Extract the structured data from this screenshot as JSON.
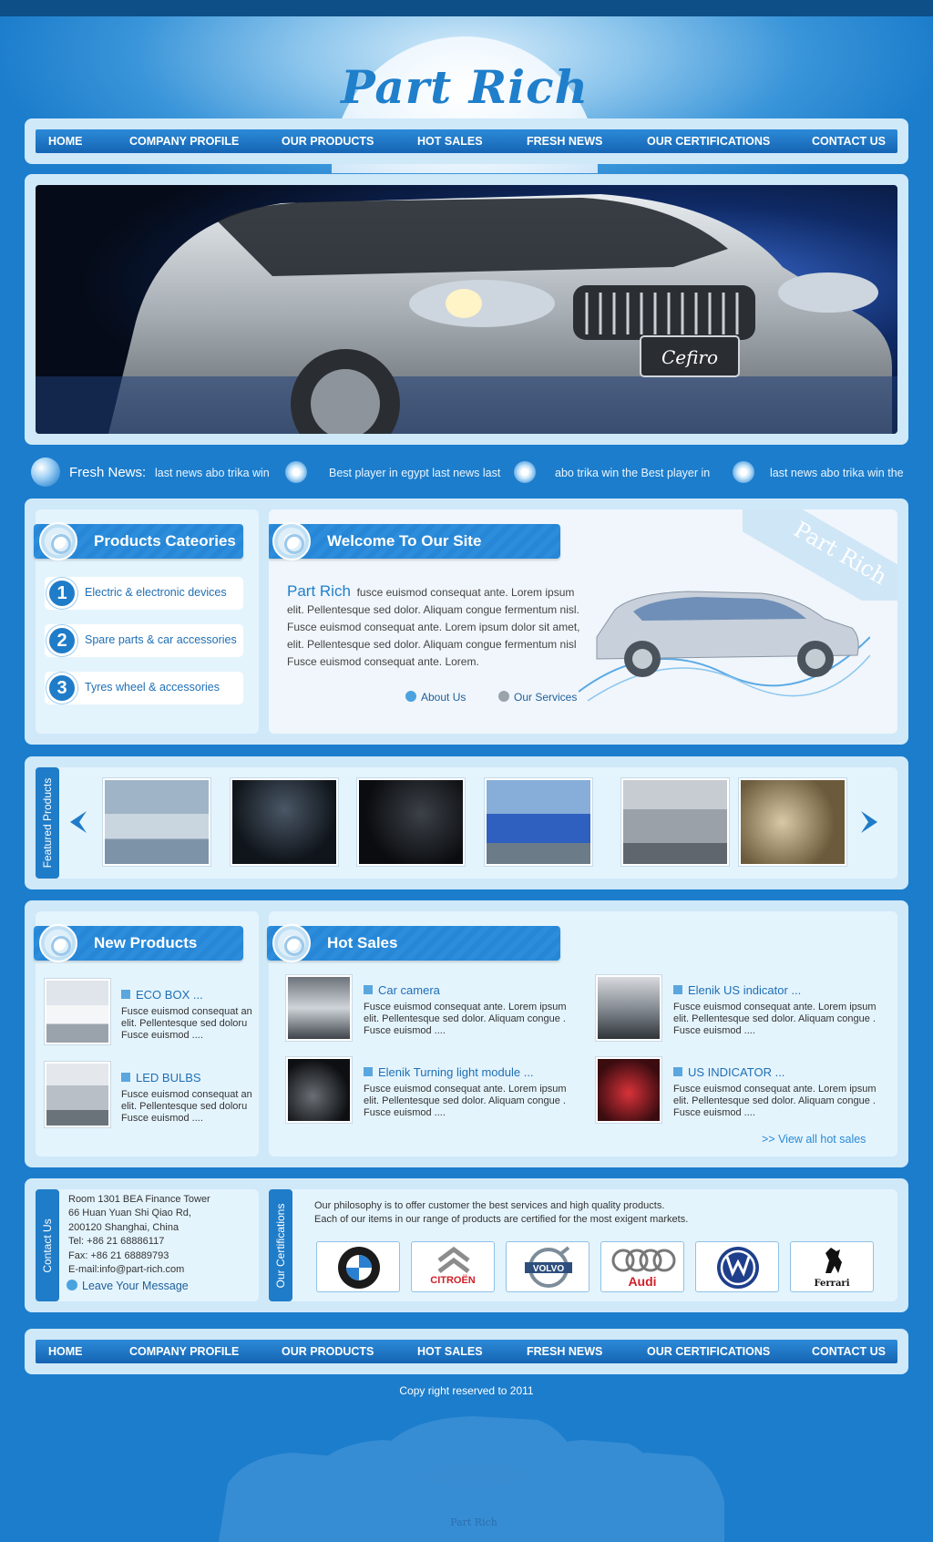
{
  "brand": {
    "logo": "Part Rich"
  },
  "nav": [
    "HOME",
    "COMPANY PROFILE",
    "OUR PRODUCTS",
    "HOT SALES",
    "FRESH NEWS",
    "OUR CERTIFICATIONS",
    "CONTACT US"
  ],
  "hero": {
    "badge": "Cefiro"
  },
  "news": {
    "label": "Fresh News:",
    "items": [
      "last news abo trika win",
      "Best player in egypt last news last",
      "abo trika win the  Best player in",
      "last news abo trika win the"
    ]
  },
  "categories": {
    "title": "Products Cateories",
    "items": [
      {
        "num": "1",
        "label": "Electric & electronic devices"
      },
      {
        "num": "2",
        "label": "Spare parts & car accessories"
      },
      {
        "num": "3",
        "label": "Tyres wheel & accessories"
      }
    ]
  },
  "welcome": {
    "title": "Welcome To Our Site",
    "ribbon": "Part Rich",
    "brand": "Part Rich",
    "text": "fusce euismod consequat ante. Lorem ipsum elit. Pellentesque sed dolor. Aliquam congue fermentum nisl. Fusce euismod consequat ante. Lorem ipsum dolor sit amet, elit. Pellentesque sed dolor. Aliquam congue fermentum nisl Fusce euismod consequat ante. Lorem.",
    "about": "About Us",
    "services": "Our Services"
  },
  "featured": {
    "label": "Featured Products"
  },
  "new_products": {
    "title": "New Products",
    "items": [
      {
        "title": "ECO BOX ...",
        "desc": "Fusce euismod consequat an elit. Pellentesque sed doloru Fusce euismod   ...."
      },
      {
        "title": "LED BULBS",
        "desc": "Fusce euismod consequat an elit. Pellentesque sed doloru Fusce euismod   ...."
      }
    ]
  },
  "hot_sales": {
    "title": "Hot Sales",
    "items": [
      {
        "title": "Car camera",
        "desc": "Fusce euismod consequat ante. Lorem ipsum elit. Pellentesque sed dolor. Aliquam congue . Fusce euismod   ...."
      },
      {
        "title": "Elenik US indicator  ...",
        "desc": "Fusce euismod consequat ante. Lorem ipsum elit. Pellentesque sed dolor. Aliquam congue . Fusce euismod   ...."
      },
      {
        "title": "Elenik Turning light module  ...",
        "desc": "Fusce euismod consequat ante. Lorem ipsum elit. Pellentesque sed dolor. Aliquam congue . Fusce euismod   ...."
      },
      {
        "title": "US INDICATOR  ...",
        "desc": "Fusce euismod consequat ante. Lorem ipsum elit. Pellentesque sed dolor. Aliquam congue . Fusce euismod   ...."
      }
    ],
    "view_all": ">> View all hot sales"
  },
  "contact": {
    "label": "Contact Us",
    "lines": [
      "Room 1301 BEA Finance Tower",
      "66 Huan Yuan Shi Qiao Rd,",
      "200120 Shanghai, China",
      "Tel: +86 21 68886117",
      "Fax: +86 21 68889793",
      "E-mail:info@part-rich.com"
    ],
    "leave_message": "Leave Your Message"
  },
  "certifications": {
    "label": "Our Certifications",
    "line1": "Our philosophy is to offer customer the best services and high quality products.",
    "line2": "Each of our items in our range of products are certified for the most exigent markets.",
    "brands": [
      "BMW",
      "CITROËN",
      "VOLVO",
      "Audi",
      "VW",
      "Ferrari"
    ]
  },
  "footer": {
    "copyright": "Copy right reserved to 2011",
    "watermark": "Part Rich"
  },
  "colors": {
    "background": "#1c7dcc",
    "panel": "#cfe9f9",
    "accent": "#1f7cc8"
  }
}
